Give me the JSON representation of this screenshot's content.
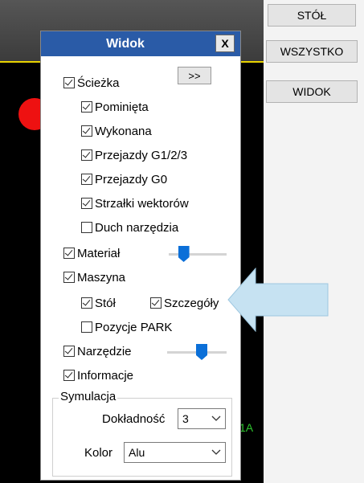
{
  "right_panel": {
    "stol_button": "STÓŁ",
    "wszystko_button": "WSZYSTKO",
    "widok_button": "WIDOK"
  },
  "canvas": {
    "label": "1A"
  },
  "dialog": {
    "title": "Widok",
    "close_label": "X",
    "expand_button": ">>",
    "items": {
      "sciezka": {
        "label": "Ścieżka",
        "checked": true
      },
      "pominieta": {
        "label": "Pominięta",
        "checked": true
      },
      "wykonana": {
        "label": "Wykonana",
        "checked": true
      },
      "przejazdy_g123": {
        "label": "Przejazdy G1/2/3",
        "checked": true
      },
      "przejazdy_g0": {
        "label": "Przejazdy G0",
        "checked": true
      },
      "strzalki": {
        "label": "Strzałki wektorów",
        "checked": true
      },
      "duch": {
        "label": "Duch narzędzia",
        "checked": false
      },
      "material": {
        "label": "Materiał",
        "checked": true
      },
      "maszyna": {
        "label": "Maszyna",
        "checked": true
      },
      "stol": {
        "label": "Stół",
        "checked": true
      },
      "szczegoly": {
        "label": "Szczegóły",
        "checked": true
      },
      "pozycje_park": {
        "label": "Pozycje PARK",
        "checked": false
      },
      "narzedzie": {
        "label": "Narzędzie",
        "checked": true
      },
      "informacje": {
        "label": "Informacje",
        "checked": true
      }
    },
    "material_slider_value": 0.2,
    "narzedzie_slider_value": 0.6,
    "symulacja": {
      "legend": "Symulacja",
      "dokladnosc_label": "Dokładność",
      "dokladnosc_value": "3",
      "kolor_label": "Kolor",
      "kolor_value": "Alu"
    }
  },
  "colors": {
    "titlebar": "#2a5ba7",
    "slider_thumb": "#0b6fd8",
    "highlight_arrow": "#c6e2f2"
  }
}
